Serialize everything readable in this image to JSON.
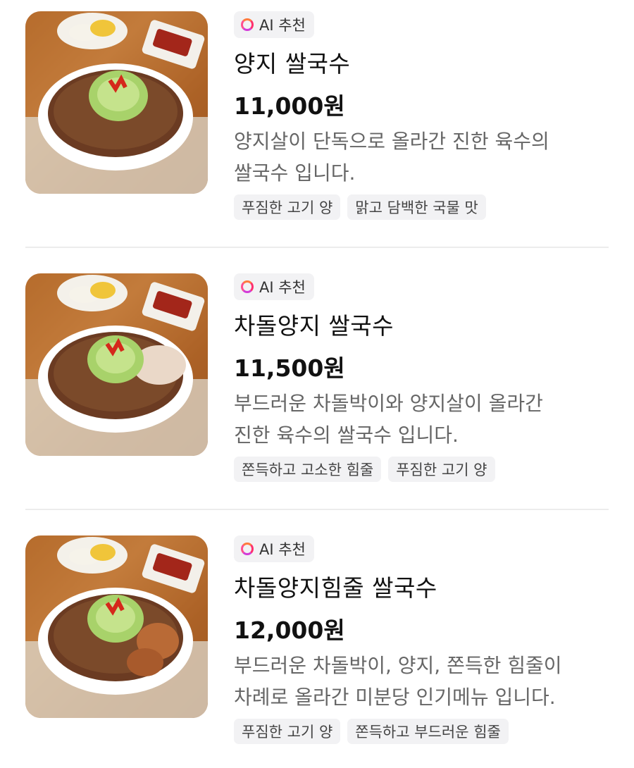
{
  "ai_badge_label": "AI 추천",
  "colors": {
    "badge_bg": "#f2f2f4",
    "tag_bg": "#f2f2f4",
    "ai_ring": "#ff3d7f",
    "description": "#666666"
  },
  "items": [
    {
      "name": "양지 쌀국수",
      "price": "11,000원",
      "description_lines": [
        "양지살이 단독으로 올라간 진한 육수의",
        "쌀국수 입니다."
      ],
      "tags": [
        "푸짐한 고기 양",
        "맑고 담백한 국물 맛"
      ],
      "image_icon": "noodle-bowl-photo"
    },
    {
      "name": "차돌양지 쌀국수",
      "price": "11,500원",
      "description_lines": [
        "부드러운 차돌박이와 양지살이 올라간",
        "진한 육수의 쌀국수 입니다."
      ],
      "tags": [
        "쫀득하고 고소한 힘줄",
        "푸짐한 고기 양"
      ],
      "image_icon": "noodle-bowl-photo"
    },
    {
      "name": "차돌양지힘줄 쌀국수",
      "price": "12,000원",
      "description_lines": [
        "부드러운 차돌박이, 양지, 쫀득한 힘줄이",
        "차례로 올라간 미분당 인기메뉴 입니다."
      ],
      "tags": [
        "푸짐한 고기 양",
        "쫀득하고 부드러운 힘줄"
      ],
      "image_icon": "noodle-bowl-photo"
    }
  ]
}
